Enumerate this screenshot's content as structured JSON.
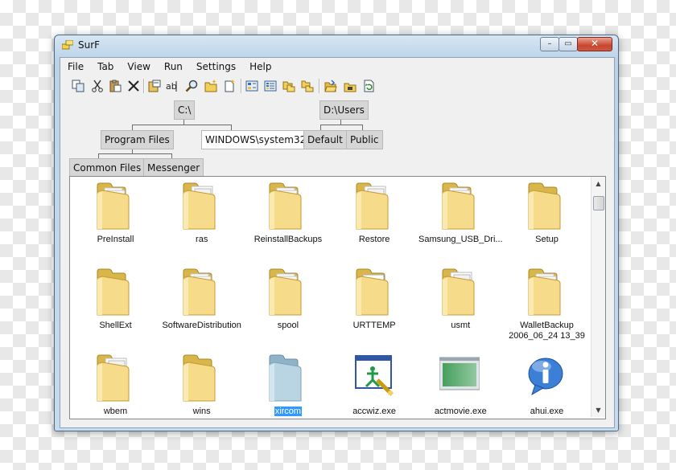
{
  "window": {
    "title": "SurF"
  },
  "controls": {
    "minimize": "–",
    "maximize": "▭",
    "close": "✕"
  },
  "menu": [
    "File",
    "Tab",
    "View",
    "Run",
    "Settings",
    "Help"
  ],
  "toolbar": [
    "copy-icon",
    "cut-icon",
    "paste-icon",
    "delete-icon",
    "properties-icon",
    "rename-icon",
    "search-icon",
    "new-folder-icon",
    "new-file-icon",
    "tile-view-icon",
    "list-view-icon",
    "large-icons-icon",
    "small-icons-icon",
    "open-folder-icon",
    "folder-up-icon",
    "refresh-icon"
  ],
  "tree": {
    "root1": "C:\\",
    "root2": "D:\\Users",
    "c_children": [
      "Program Files",
      "WINDOWS\\system32"
    ],
    "d_children": [
      "Default",
      "Public"
    ],
    "pf_children": [
      "Common Files",
      "Messenger"
    ]
  },
  "files": [
    {
      "name": "PreInstall",
      "icon": "folder-docs-icon"
    },
    {
      "name": "ras",
      "icon": "folder-white-docs-icon"
    },
    {
      "name": "ReinstallBackups",
      "icon": "folder-docs-icon"
    },
    {
      "name": "Restore",
      "icon": "folder-white-docs-icon"
    },
    {
      "name": "Samsung_USB_Dri...",
      "icon": "folder-docs-icon"
    },
    {
      "name": "Setup",
      "icon": "folder-icon"
    },
    {
      "name": "ShellExt",
      "icon": "folder-icon"
    },
    {
      "name": "SoftwareDistribution",
      "icon": "folder-docs-icon"
    },
    {
      "name": "spool",
      "icon": "folder-docs-icon"
    },
    {
      "name": "URTTEMP",
      "icon": "folder-app-icon"
    },
    {
      "name": "usmt",
      "icon": "folder-white-docs-icon"
    },
    {
      "name": "WalletBackup\n2006_06_24 13_39",
      "icon": "folder-docs-icon"
    },
    {
      "name": "wbem",
      "icon": "folder-white-docs-icon"
    },
    {
      "name": "wins",
      "icon": "folder-icon"
    },
    {
      "name": "xircom",
      "icon": "folder-blue-icon",
      "selected": true
    },
    {
      "name": "accwiz.exe",
      "icon": "accessibility-wizard-icon"
    },
    {
      "name": "actmovie.exe",
      "icon": "activemovie-window-icon"
    },
    {
      "name": "ahui.exe",
      "icon": "info-bubble-icon"
    }
  ],
  "scroll": {
    "up": "▲",
    "down": "▼"
  }
}
